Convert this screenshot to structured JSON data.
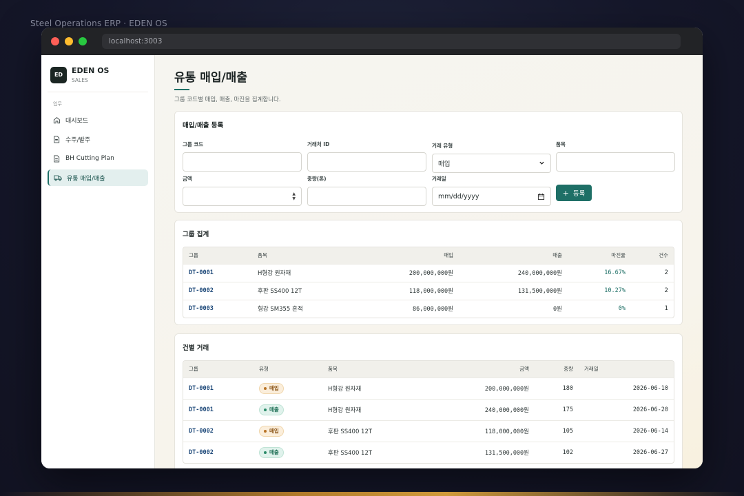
{
  "desktop_title": "Steel Operations ERP · EDEN OS",
  "browser": {
    "url": "localhost:3003"
  },
  "brand": {
    "logo": "ED",
    "name": "EDEN OS",
    "sub": "SALES"
  },
  "nav": {
    "section": "업무",
    "items": [
      {
        "label": "대시보드",
        "icon": "home-icon"
      },
      {
        "label": "수주/발주",
        "icon": "document-icon"
      },
      {
        "label": "BH Cutting Plan",
        "icon": "document-icon"
      },
      {
        "label": "유통 매입/매출",
        "icon": "truck-icon",
        "active": true
      }
    ]
  },
  "page": {
    "title": "유통 매입/매출",
    "desc": "그룹 코드별 매입, 매출, 마진을 집계합니다."
  },
  "form": {
    "title": "매입/매출 등록",
    "group_code_label": "그룹 코드",
    "partner_id_label": "거래처 ID",
    "type_label": "거래 유형",
    "type_value": "매입",
    "item_label": "품목",
    "amount_label": "금액",
    "weight_label": "중량(톤)",
    "date_label": "거래일",
    "date_placeholder": "mm/dd/yyyy",
    "submit_label": "등록"
  },
  "summary": {
    "title": "그룹 집계",
    "headers": [
      "그룹",
      "품목",
      "매입",
      "매출",
      "마진율",
      "건수"
    ],
    "rows": [
      {
        "group": "DT-0001",
        "item": "H형강 원자재",
        "buy": "200,000,000원",
        "sell": "240,000,000원",
        "margin": "16.67%",
        "count": "2"
      },
      {
        "group": "DT-0002",
        "item": "후판 SS400 12T",
        "buy": "118,000,000원",
        "sell": "131,500,000원",
        "margin": "10.27%",
        "count": "2"
      },
      {
        "group": "DT-0003",
        "item": "형강 SM355 혼적",
        "buy": "86,000,000원",
        "sell": "0원",
        "margin": "0%",
        "count": "1"
      }
    ]
  },
  "transactions": {
    "title": "건별 거래",
    "headers": [
      "그룹",
      "유형",
      "품목",
      "금액",
      "중량",
      "거래일"
    ],
    "rows": [
      {
        "group": "DT-0001",
        "type": "매입",
        "kind": "buy",
        "item": "H형강 원자재",
        "amount": "200,000,000원",
        "weight": "180",
        "date": "2026-06-10"
      },
      {
        "group": "DT-0001",
        "type": "매출",
        "kind": "sell",
        "item": "H형강 원자재",
        "amount": "240,000,000원",
        "weight": "175",
        "date": "2026-06-20"
      },
      {
        "group": "DT-0002",
        "type": "매입",
        "kind": "buy",
        "item": "후판 SS400 12T",
        "amount": "118,000,000원",
        "weight": "105",
        "date": "2026-06-14"
      },
      {
        "group": "DT-0002",
        "type": "매출",
        "kind": "sell",
        "item": "후판 SS400 12T",
        "amount": "131,500,000원",
        "weight": "102",
        "date": "2026-06-27"
      }
    ]
  },
  "colors": {
    "accent": "#1e6f66",
    "code": "#1f4a7a",
    "buy_badge": "#fbeedb",
    "sell_badge": "#e0f2ec"
  }
}
